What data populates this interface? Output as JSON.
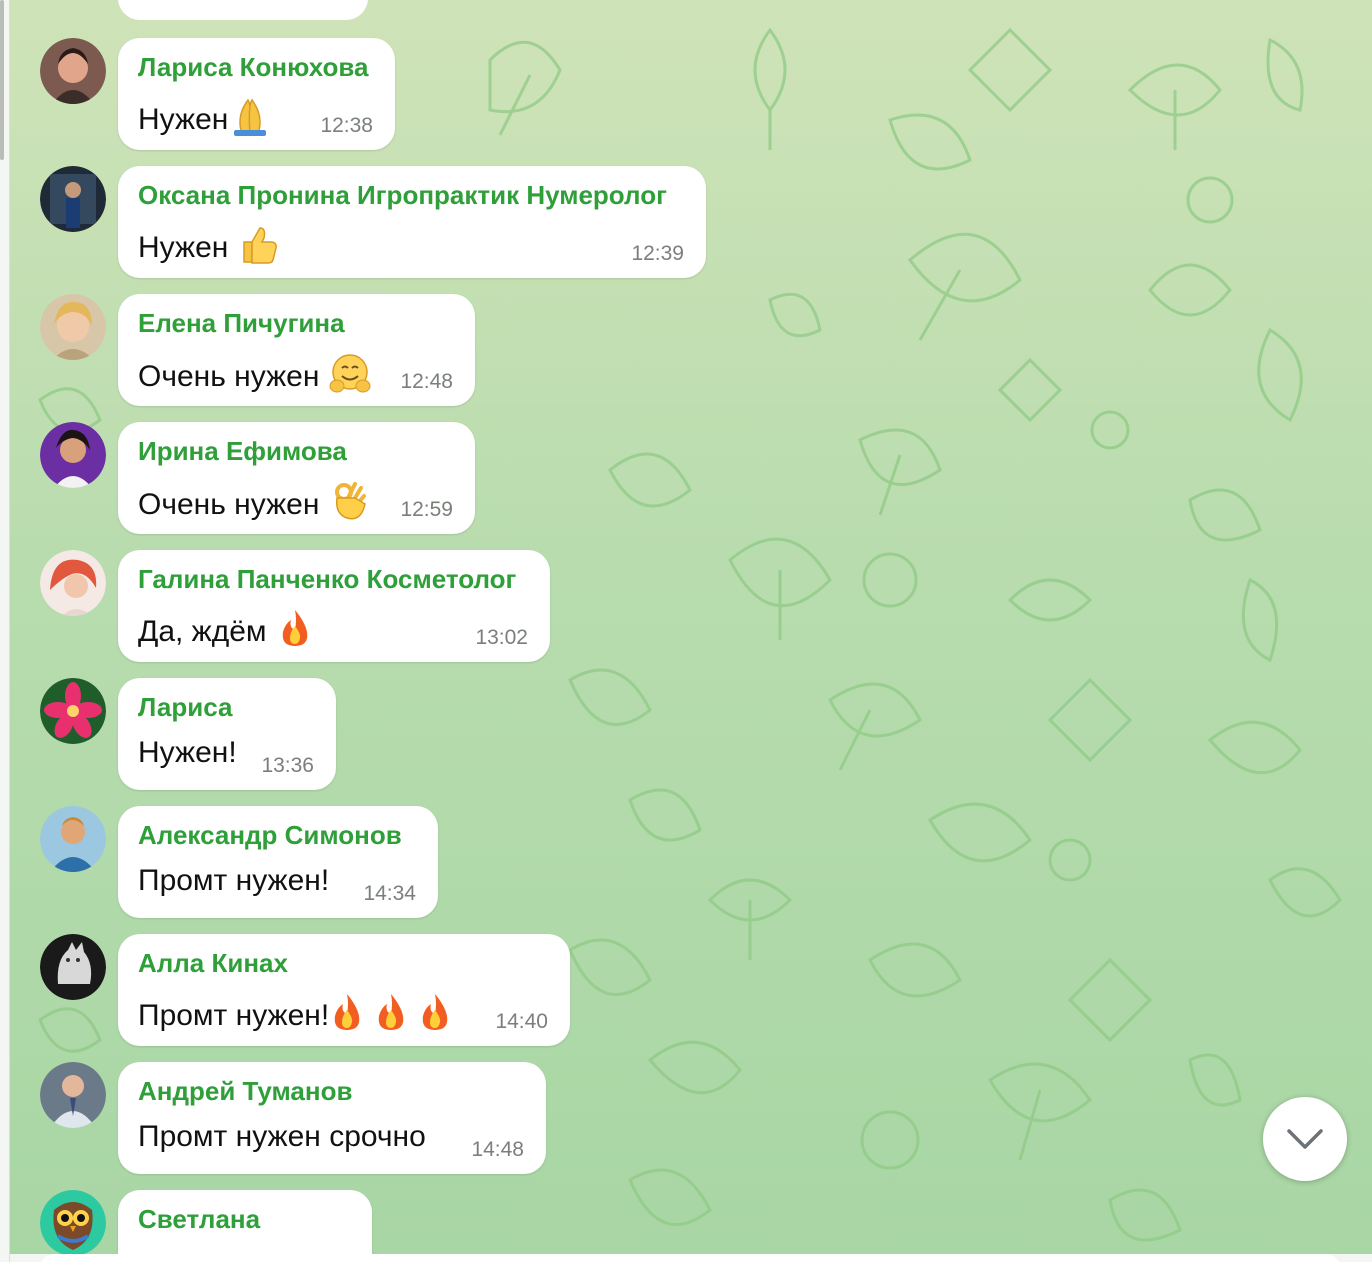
{
  "colors": {
    "sender": "#2f9f3a",
    "bubble": "#ffffff",
    "time": "#7a7f7a",
    "background": "#b8dcae"
  },
  "messages": [
    {
      "sender": "Лариса Конюхова",
      "text": "Нужен",
      "emoji": "pray-emoji",
      "time": "12:38"
    },
    {
      "sender": "Оксана Пронина Игропрактик Нумеролог",
      "text": "Нужен",
      "emoji": "thumbs-up-emoji",
      "time": "12:39"
    },
    {
      "sender": "Елена Пичугина",
      "text": "Очень нужен",
      "emoji": "hugging-face-emoji",
      "time": "12:48"
    },
    {
      "sender": "Ирина Ефимова",
      "text": "Очень нужен",
      "emoji": "ok-hand-emoji",
      "time": "12:59"
    },
    {
      "sender": "Галина Панченко Косметолог",
      "text": "Да, ждём",
      "emoji": "fire-emoji",
      "time": "13:02"
    },
    {
      "sender": "Лариса",
      "text": "Нужен!",
      "emoji": "",
      "time": "13:36"
    },
    {
      "sender": "Александр Симонов",
      "text": "Промт нужен!",
      "emoji": "",
      "time": "14:34"
    },
    {
      "sender": "Алла Кинах",
      "text": "Промт нужен!",
      "emoji": "fire-emoji x3",
      "time": "14:40"
    },
    {
      "sender": "Андрей Туманов",
      "text": "Промт нужен срочно",
      "emoji": "",
      "time": "14:48"
    },
    {
      "sender": "Светлана",
      "text": "",
      "emoji": "",
      "time": ""
    }
  ],
  "scroll_button": {
    "icon": "chevron-down-icon"
  }
}
